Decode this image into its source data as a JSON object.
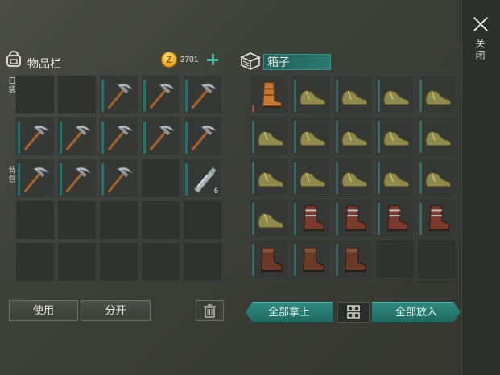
{
  "inventory": {
    "title": "物品栏",
    "coins": "3701",
    "pocket_label": "口袋",
    "backpack_label": "背包",
    "rows": [
      [
        "",
        "",
        "pickaxe",
        "pickaxe",
        "pickaxe"
      ],
      [
        "pickaxe",
        "pickaxe",
        "pickaxe",
        "pickaxe",
        "pickaxe"
      ],
      [
        "pickaxe",
        "pickaxe",
        "pickaxe",
        "",
        "bottle"
      ],
      [
        "",
        "",
        "",
        "",
        ""
      ],
      [
        "",
        "",
        "",
        "",
        ""
      ]
    ],
    "bottle_count": "6",
    "use_label": "使用",
    "split_label": "分开"
  },
  "box": {
    "title": "箱子",
    "rows": [
      [
        "orange-boots",
        "green-shoes",
        "green-shoes",
        "green-shoes",
        "green-shoes"
      ],
      [
        "green-shoes",
        "green-shoes",
        "green-shoes",
        "green-shoes",
        "green-shoes"
      ],
      [
        "green-shoes",
        "green-shoes",
        "green-shoes",
        "green-shoes",
        "green-shoes"
      ],
      [
        "green-shoes",
        "leather-boots",
        "leather-boots",
        "leather-boots",
        "leather-boots"
      ],
      [
        "brown-boots",
        "brown-boots",
        "brown-boots",
        "",
        ""
      ]
    ],
    "take_all_label": "全部拿上",
    "put_all_label": "全部放入"
  },
  "close_label": "关闭",
  "colors": {
    "accent_teal": "#2b7a72",
    "coin_gold": "#e3a514",
    "plus_green": "#3fc0a0",
    "durability_red": "#c83a2c"
  },
  "icons": [
    "backpack-icon",
    "coin-icon",
    "plus-icon",
    "box-icon",
    "close-icon",
    "trash-icon",
    "grid-icon"
  ]
}
